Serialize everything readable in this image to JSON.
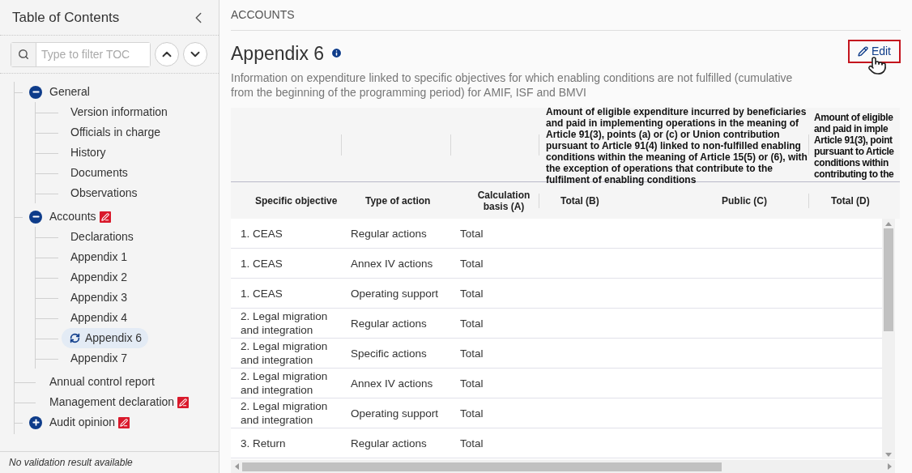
{
  "sidebar": {
    "title": "Table of Contents",
    "filter": {
      "placeholder": "Type to filter TOC"
    },
    "tree": [
      {
        "label": "General",
        "kind": "node",
        "expanded": true,
        "edited": false,
        "selected": false,
        "children": [
          {
            "label": "Version information",
            "edited": false,
            "selected": false
          },
          {
            "label": "Officials in charge",
            "edited": false,
            "selected": false
          },
          {
            "label": "History",
            "edited": false,
            "selected": false
          },
          {
            "label": "Documents",
            "edited": false,
            "selected": false
          },
          {
            "label": "Observations",
            "edited": false,
            "selected": false
          }
        ]
      },
      {
        "label": "Accounts",
        "kind": "node",
        "expanded": true,
        "edited": true,
        "selected": false,
        "children": [
          {
            "label": "Declarations",
            "edited": false,
            "selected": false
          },
          {
            "label": "Appendix 1",
            "edited": false,
            "selected": false
          },
          {
            "label": "Appendix 2",
            "edited": false,
            "selected": false
          },
          {
            "label": "Appendix 3",
            "edited": false,
            "selected": false
          },
          {
            "label": "Appendix 4",
            "edited": false,
            "selected": false
          },
          {
            "label": "Appendix 6",
            "edited": false,
            "selected": true
          },
          {
            "label": "Appendix 7",
            "edited": false,
            "selected": false
          }
        ]
      },
      {
        "label": "Annual control report",
        "kind": "leaf",
        "edited": false,
        "selected": false
      },
      {
        "label": "Management declaration",
        "kind": "leaf",
        "edited": true,
        "selected": false
      },
      {
        "label": "Audit opinion",
        "kind": "node",
        "expanded": false,
        "edited": true,
        "selected": false
      }
    ],
    "status": "No validation result available"
  },
  "breadcrumb": "ACCOUNTS",
  "page": {
    "title": "Appendix 6",
    "description": "Information on expenditure linked to specific objectives for which enabling conditions are not fulfilled (cumulative from the beginning of the programming period) for AMIF, ISF and BMVI",
    "edit_button": "Edit"
  },
  "table": {
    "group_headers": [
      {
        "lines": [
          "Amount of eligible expenditure incurred by beneficiaries",
          "and paid in implementing operations in the meaning of",
          "Article 91(3), points (a) or (c) or Union contribution",
          "pursuant to Article 91(4) linked to non-fulfilled enabling",
          "conditions within the meaning of Article 15(5) or (6), with",
          "the exception of operations that contribute to the",
          "fulfilment of enabling conditions"
        ]
      },
      {
        "lines": [
          "Amount of eligible",
          "and paid in imple",
          "Article 91(3), point",
          "pursuant to Article",
          "conditions within",
          "contributing to the"
        ]
      }
    ],
    "columns": [
      "Specific objective",
      "Type of action",
      "Calculation basis (A)",
      "Total (B)",
      "Public (C)",
      "Total (D)"
    ],
    "rows": [
      [
        "1. CEAS",
        "Regular actions",
        "Total"
      ],
      [
        "1. CEAS",
        "Annex IV actions",
        "Total"
      ],
      [
        "1. CEAS",
        "Operating support",
        "Total"
      ],
      [
        "2. Legal migration and integration",
        "Regular actions",
        "Total"
      ],
      [
        "2. Legal migration and integration",
        "Specific actions",
        "Total"
      ],
      [
        "2. Legal migration and integration",
        "Annex IV actions",
        "Total"
      ],
      [
        "2. Legal migration and integration",
        "Operating support",
        "Total"
      ],
      [
        "3. Return",
        "Regular actions",
        "Total"
      ]
    ]
  }
}
